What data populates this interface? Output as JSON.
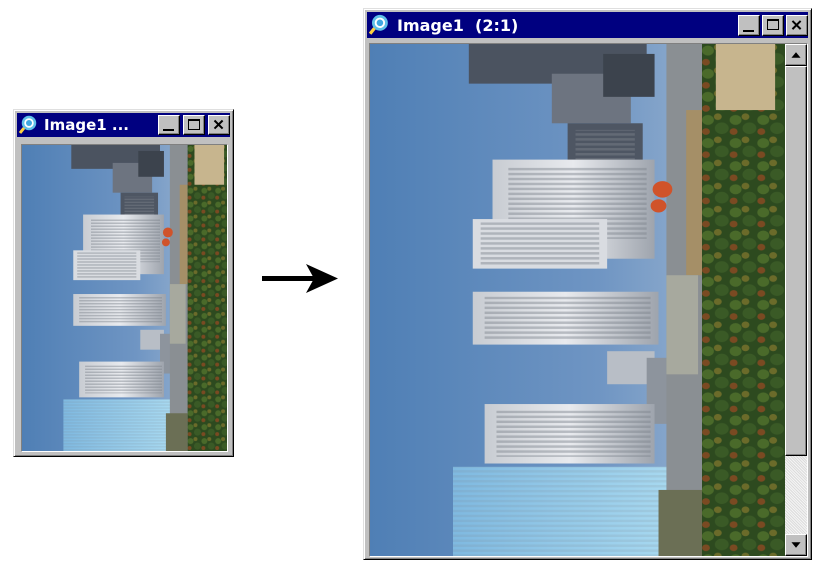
{
  "small_window": {
    "title": "Image1 ...",
    "icon": "magnifier-icon",
    "buttons": [
      "minimize",
      "maximize",
      "close"
    ]
  },
  "large_window": {
    "title": "Image1  (2:1)",
    "icon": "magnifier-icon",
    "buttons": [
      "minimize",
      "maximize",
      "close"
    ],
    "scrollbar": {
      "orientation": "vertical",
      "position": 0.0
    }
  },
  "transition_arrow": {
    "icon": "right-arrow-icon"
  },
  "colors": {
    "titlebar": "#000080",
    "title_text": "#ffffff",
    "chrome": "#c0c0c0",
    "sky": "#5f87b8",
    "glass_tower": "#8ec4e6",
    "trees": "#2f4a22"
  }
}
